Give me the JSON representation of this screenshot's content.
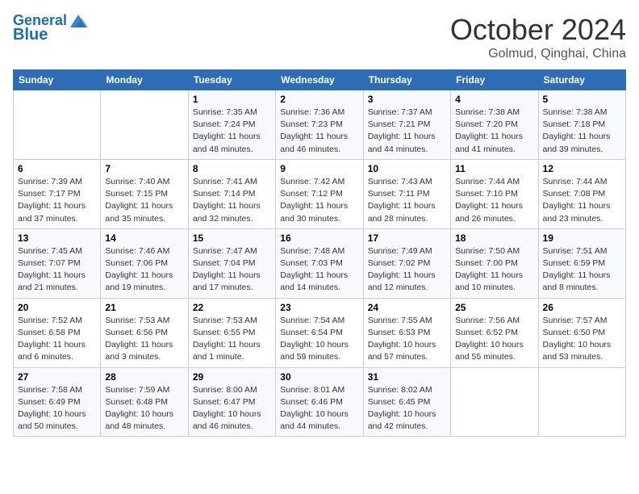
{
  "header": {
    "logo_text_general": "General",
    "logo_text_blue": "Blue",
    "month": "October 2024",
    "location": "Golmud, Qinghai, China"
  },
  "days_of_week": [
    "Sunday",
    "Monday",
    "Tuesday",
    "Wednesday",
    "Thursday",
    "Friday",
    "Saturday"
  ],
  "weeks": [
    [
      {
        "day": "",
        "sunrise": "",
        "sunset": "",
        "daylight": ""
      },
      {
        "day": "",
        "sunrise": "",
        "sunset": "",
        "daylight": ""
      },
      {
        "day": "1",
        "sunrise": "Sunrise: 7:35 AM",
        "sunset": "Sunset: 7:24 PM",
        "daylight": "Daylight: 11 hours and 48 minutes."
      },
      {
        "day": "2",
        "sunrise": "Sunrise: 7:36 AM",
        "sunset": "Sunset: 7:23 PM",
        "daylight": "Daylight: 11 hours and 46 minutes."
      },
      {
        "day": "3",
        "sunrise": "Sunrise: 7:37 AM",
        "sunset": "Sunset: 7:21 PM",
        "daylight": "Daylight: 11 hours and 44 minutes."
      },
      {
        "day": "4",
        "sunrise": "Sunrise: 7:38 AM",
        "sunset": "Sunset: 7:20 PM",
        "daylight": "Daylight: 11 hours and 41 minutes."
      },
      {
        "day": "5",
        "sunrise": "Sunrise: 7:38 AM",
        "sunset": "Sunset: 7:18 PM",
        "daylight": "Daylight: 11 hours and 39 minutes."
      }
    ],
    [
      {
        "day": "6",
        "sunrise": "Sunrise: 7:39 AM",
        "sunset": "Sunset: 7:17 PM",
        "daylight": "Daylight: 11 hours and 37 minutes."
      },
      {
        "day": "7",
        "sunrise": "Sunrise: 7:40 AM",
        "sunset": "Sunset: 7:15 PM",
        "daylight": "Daylight: 11 hours and 35 minutes."
      },
      {
        "day": "8",
        "sunrise": "Sunrise: 7:41 AM",
        "sunset": "Sunset: 7:14 PM",
        "daylight": "Daylight: 11 hours and 32 minutes."
      },
      {
        "day": "9",
        "sunrise": "Sunrise: 7:42 AM",
        "sunset": "Sunset: 7:12 PM",
        "daylight": "Daylight: 11 hours and 30 minutes."
      },
      {
        "day": "10",
        "sunrise": "Sunrise: 7:43 AM",
        "sunset": "Sunset: 7:11 PM",
        "daylight": "Daylight: 11 hours and 28 minutes."
      },
      {
        "day": "11",
        "sunrise": "Sunrise: 7:44 AM",
        "sunset": "Sunset: 7:10 PM",
        "daylight": "Daylight: 11 hours and 26 minutes."
      },
      {
        "day": "12",
        "sunrise": "Sunrise: 7:44 AM",
        "sunset": "Sunset: 7:08 PM",
        "daylight": "Daylight: 11 hours and 23 minutes."
      }
    ],
    [
      {
        "day": "13",
        "sunrise": "Sunrise: 7:45 AM",
        "sunset": "Sunset: 7:07 PM",
        "daylight": "Daylight: 11 hours and 21 minutes."
      },
      {
        "day": "14",
        "sunrise": "Sunrise: 7:46 AM",
        "sunset": "Sunset: 7:06 PM",
        "daylight": "Daylight: 11 hours and 19 minutes."
      },
      {
        "day": "15",
        "sunrise": "Sunrise: 7:47 AM",
        "sunset": "Sunset: 7:04 PM",
        "daylight": "Daylight: 11 hours and 17 minutes."
      },
      {
        "day": "16",
        "sunrise": "Sunrise: 7:48 AM",
        "sunset": "Sunset: 7:03 PM",
        "daylight": "Daylight: 11 hours and 14 minutes."
      },
      {
        "day": "17",
        "sunrise": "Sunrise: 7:49 AM",
        "sunset": "Sunset: 7:02 PM",
        "daylight": "Daylight: 11 hours and 12 minutes."
      },
      {
        "day": "18",
        "sunrise": "Sunrise: 7:50 AM",
        "sunset": "Sunset: 7:00 PM",
        "daylight": "Daylight: 11 hours and 10 minutes."
      },
      {
        "day": "19",
        "sunrise": "Sunrise: 7:51 AM",
        "sunset": "Sunset: 6:59 PM",
        "daylight": "Daylight: 11 hours and 8 minutes."
      }
    ],
    [
      {
        "day": "20",
        "sunrise": "Sunrise: 7:52 AM",
        "sunset": "Sunset: 6:58 PM",
        "daylight": "Daylight: 11 hours and 6 minutes."
      },
      {
        "day": "21",
        "sunrise": "Sunrise: 7:53 AM",
        "sunset": "Sunset: 6:56 PM",
        "daylight": "Daylight: 11 hours and 3 minutes."
      },
      {
        "day": "22",
        "sunrise": "Sunrise: 7:53 AM",
        "sunset": "Sunset: 6:55 PM",
        "daylight": "Daylight: 11 hours and 1 minute."
      },
      {
        "day": "23",
        "sunrise": "Sunrise: 7:54 AM",
        "sunset": "Sunset: 6:54 PM",
        "daylight": "Daylight: 10 hours and 59 minutes."
      },
      {
        "day": "24",
        "sunrise": "Sunrise: 7:55 AM",
        "sunset": "Sunset: 6:53 PM",
        "daylight": "Daylight: 10 hours and 57 minutes."
      },
      {
        "day": "25",
        "sunrise": "Sunrise: 7:56 AM",
        "sunset": "Sunset: 6:52 PM",
        "daylight": "Daylight: 10 hours and 55 minutes."
      },
      {
        "day": "26",
        "sunrise": "Sunrise: 7:57 AM",
        "sunset": "Sunset: 6:50 PM",
        "daylight": "Daylight: 10 hours and 53 minutes."
      }
    ],
    [
      {
        "day": "27",
        "sunrise": "Sunrise: 7:58 AM",
        "sunset": "Sunset: 6:49 PM",
        "daylight": "Daylight: 10 hours and 50 minutes."
      },
      {
        "day": "28",
        "sunrise": "Sunrise: 7:59 AM",
        "sunset": "Sunset: 6:48 PM",
        "daylight": "Daylight: 10 hours and 48 minutes."
      },
      {
        "day": "29",
        "sunrise": "Sunrise: 8:00 AM",
        "sunset": "Sunset: 6:47 PM",
        "daylight": "Daylight: 10 hours and 46 minutes."
      },
      {
        "day": "30",
        "sunrise": "Sunrise: 8:01 AM",
        "sunset": "Sunset: 6:46 PM",
        "daylight": "Daylight: 10 hours and 44 minutes."
      },
      {
        "day": "31",
        "sunrise": "Sunrise: 8:02 AM",
        "sunset": "Sunset: 6:45 PM",
        "daylight": "Daylight: 10 hours and 42 minutes."
      },
      {
        "day": "",
        "sunrise": "",
        "sunset": "",
        "daylight": ""
      },
      {
        "day": "",
        "sunrise": "",
        "sunset": "",
        "daylight": ""
      }
    ]
  ]
}
